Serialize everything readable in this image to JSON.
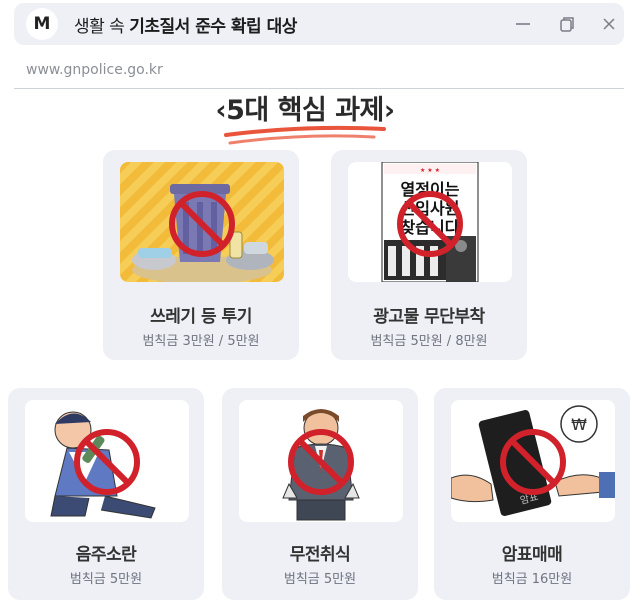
{
  "window": {
    "avatar_letter": "M",
    "title_plain": "생활 속 ",
    "title_bold": "기초질서 준수 확립 대상",
    "controls": [
      "minimize-icon",
      "restore-icon",
      "close-icon"
    ]
  },
  "address": {
    "url": "www.gnpolice.go.kr"
  },
  "heading": {
    "text": "‹5대 핵심 과제›"
  },
  "cards": [
    {
      "name": "쓰레기 등 투기",
      "fine": "범칙금 3만원 / 5만원",
      "image": "trash-bin-illustration"
    },
    {
      "name": "광고물 무단부착",
      "fine": "범칙금 5만원 / 8만원",
      "image": "flyer-poster-illustration",
      "poster_lines": [
        "열정이는",
        "신입사원",
        "찾습니다"
      ]
    },
    {
      "name": "음주소란",
      "fine": "범칙금 5만원",
      "image": "drunk-man-illustration"
    },
    {
      "name": "무전취식",
      "fine": "범칙금 5만원",
      "image": "empty-pockets-man-illustration"
    },
    {
      "name": "암표매매",
      "fine": "범칙금 16만원",
      "image": "ticket-scalping-illustration",
      "ticket_label": "암표"
    }
  ]
}
